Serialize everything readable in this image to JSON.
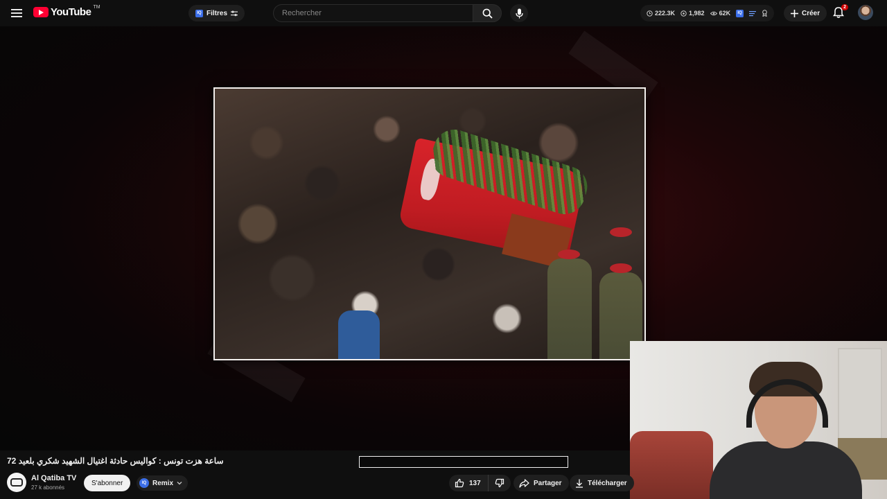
{
  "topbar": {
    "logo_text": "YouTube",
    "logo_tm": "TM",
    "filters_label": "Filtres",
    "filters_badge": "IQ",
    "search_placeholder": "Rechercher",
    "stats": {
      "views": "222.3K",
      "count2": "1,982",
      "count3": "62K"
    },
    "stats_badge": "IQ",
    "create_label": "Créer",
    "notification_count": "2"
  },
  "video": {
    "title": "72 ساعة هزت تونس : كواليس حادثة اغتيال الشهيد شكري بلعيد"
  },
  "channel": {
    "name": "Al Qatiba TV",
    "subscribers": "27 k abonnés",
    "subscribe_label": "S'abonner"
  },
  "actions": {
    "remix_label": "Remix",
    "remix_badge": "IQ",
    "like_count": "137",
    "share_label": "Partager",
    "download_label": "Télécharger"
  },
  "colors": {
    "brand_red": "#ff0033",
    "badge_blue": "#3b6ee8",
    "notification_red": "#cc0000"
  }
}
